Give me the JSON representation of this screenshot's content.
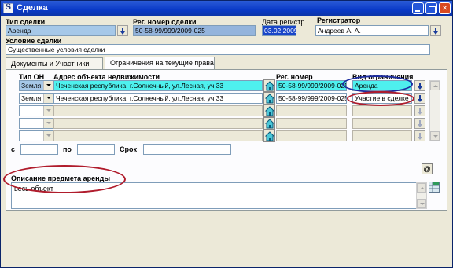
{
  "window": {
    "title": "Сделка"
  },
  "header": {
    "deal_type_label": "Тип сделки",
    "deal_type_value": "Аренда",
    "reg_number_label": "Рег. номер сделки",
    "reg_number_value": "50-58-99/999/2009-025",
    "reg_date_label": "Дата регистр.",
    "reg_date_value": "03.02.2009",
    "registrar_label": "Регистратор",
    "registrar_value": "Андреев А. А.",
    "condition_label": "Условие сделки",
    "condition_value": "Существенные условия сделки"
  },
  "tabs": [
    {
      "label": "Документы и Участники"
    },
    {
      "label": "Ограничения на текущие права"
    }
  ],
  "grid": {
    "col_type": "Тип ОН",
    "col_address": "Адрес объекта недвижимости",
    "col_reg": "Рег. номер",
    "col_kind": "Вид ограничения",
    "rows": [
      {
        "type": "Земля",
        "address": "Чеченская республика, г.Солнечный, ул.Лесная, уч.33",
        "reg": "50-58-99/999/2009-025",
        "kind": "Аренда"
      },
      {
        "type": "Земля",
        "address": "Чеченская республика, г.Солнечный, ул.Лесная, уч.33",
        "reg": "50-58-99/999/2009-025",
        "kind": "Участие в сделке"
      },
      {
        "type": "",
        "address": "",
        "reg": "",
        "kind": ""
      },
      {
        "type": "",
        "address": "",
        "reg": "",
        "kind": ""
      },
      {
        "type": "",
        "address": "",
        "reg": "",
        "kind": ""
      }
    ]
  },
  "period": {
    "from_label": "с",
    "to_label": "по",
    "term_label": "Срок",
    "from_value": "",
    "to_value": "",
    "term_value": ""
  },
  "description": {
    "label": "Описание предмета аренды",
    "value": "весь объект"
  },
  "at_button": "@"
}
